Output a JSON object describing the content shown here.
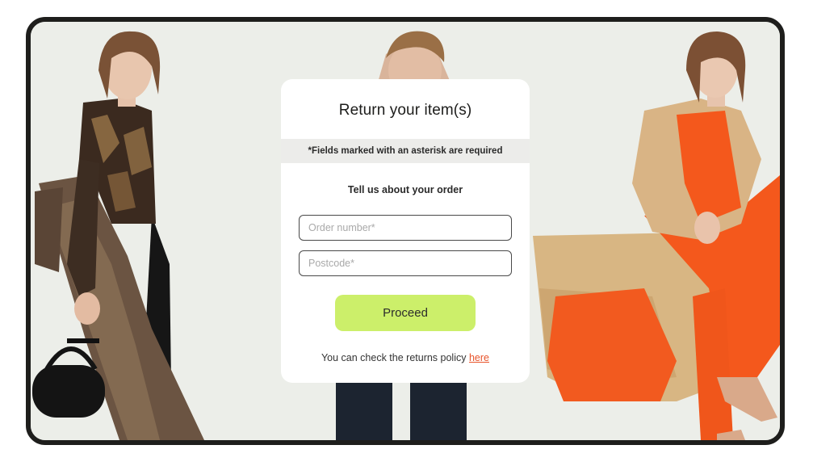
{
  "form": {
    "title": "Return your item(s)",
    "required_notice": "*Fields marked with an asterisk are required",
    "section_title": "Tell us about your order",
    "order_number_placeholder": "Order number*",
    "order_number_value": "",
    "postcode_placeholder": "Postcode*",
    "postcode_value": "",
    "proceed_label": "Proceed",
    "policy_text": "You can check the returns policy ",
    "policy_link_label": "here"
  },
  "colors": {
    "accent_button": "#ccef6a",
    "link": "#e8542b",
    "frame": "#1e1e1c",
    "background": "#ebedea"
  }
}
